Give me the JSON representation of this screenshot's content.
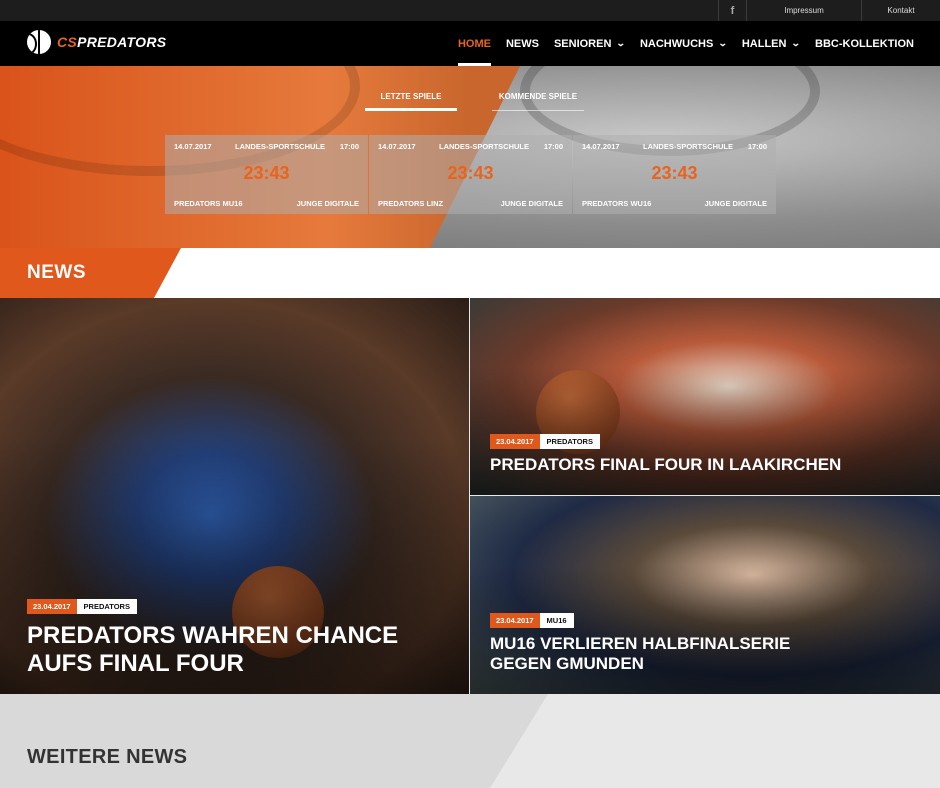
{
  "topbar": {
    "facebook_icon": "facebook-icon",
    "impressum": "Impressum",
    "kontakt": "Kontakt"
  },
  "brand": {
    "prefix": "CS",
    "name": "PREDATORS",
    "accent_color": "#e8641e"
  },
  "nav": {
    "items": [
      {
        "label": "HOME",
        "active": true,
        "dropdown": false
      },
      {
        "label": "NEWS",
        "active": false,
        "dropdown": false
      },
      {
        "label": "SENIOREN",
        "active": false,
        "dropdown": true
      },
      {
        "label": "NACHWUCHS",
        "active": false,
        "dropdown": true
      },
      {
        "label": "HALLEN",
        "active": false,
        "dropdown": true
      },
      {
        "label": "BBC-KOLLEKTION",
        "active": false,
        "dropdown": false
      }
    ]
  },
  "games": {
    "tabs": [
      {
        "label": "LETZTE SPIELE",
        "active": true
      },
      {
        "label": "KOMMENDE SPIELE",
        "active": false
      }
    ],
    "cards": [
      {
        "date": "14.07.2017",
        "venue": "LANDES-SPORTSCHULE",
        "time": "17:00",
        "score": "23:43",
        "home": "PREDATORS MU16",
        "away": "JUNGE DIGITALE"
      },
      {
        "date": "14.07.2017",
        "venue": "LANDES-SPORTSCHULE",
        "time": "17:00",
        "score": "23:43",
        "home": "PREDATORS LINZ",
        "away": "JUNGE DIGITALE"
      },
      {
        "date": "14.07.2017",
        "venue": "LANDES-SPORTSCHULE",
        "time": "17:00",
        "score": "23:43",
        "home": "PREDATORS WU16",
        "away": "JUNGE DIGITALE"
      }
    ]
  },
  "news": {
    "heading": "NEWS",
    "articles": [
      {
        "date": "23.04.2017",
        "category": "PREDATORS",
        "title_line1": "PREDATORS WAHREN CHANCE",
        "title_line2": "AUFS FINAL FOUR"
      },
      {
        "date": "23.04.2017",
        "category": "PREDATORS",
        "title_line1": "PREDATORS FINAL FOUR IN LAAKIRCHEN",
        "title_line2": ""
      },
      {
        "date": "23.04.2017",
        "category": "MU16",
        "title_line1": "MU16 VERLIEREN HALBFINALSERIE",
        "title_line2": "GEGEN GMUNDEN"
      }
    ]
  },
  "weitere": {
    "heading": "WEITERE NEWS"
  }
}
